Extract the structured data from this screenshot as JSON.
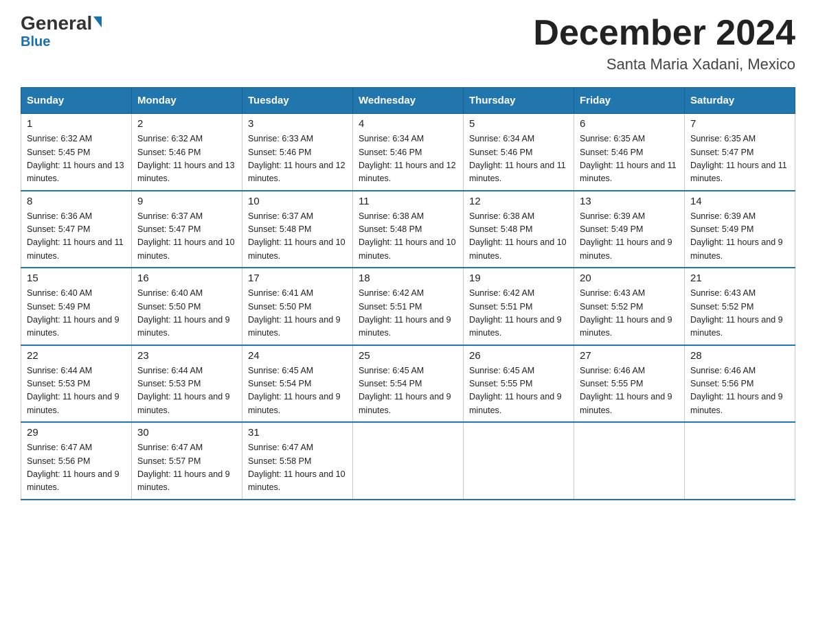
{
  "logo": {
    "general": "General",
    "blue": "Blue"
  },
  "title": "December 2024",
  "subtitle": "Santa Maria Xadani, Mexico",
  "days_of_week": [
    "Sunday",
    "Monday",
    "Tuesday",
    "Wednesday",
    "Thursday",
    "Friday",
    "Saturday"
  ],
  "weeks": [
    [
      {
        "day": "1",
        "sunrise": "6:32 AM",
        "sunset": "5:45 PM",
        "daylight": "11 hours and 13 minutes."
      },
      {
        "day": "2",
        "sunrise": "6:32 AM",
        "sunset": "5:46 PM",
        "daylight": "11 hours and 13 minutes."
      },
      {
        "day": "3",
        "sunrise": "6:33 AM",
        "sunset": "5:46 PM",
        "daylight": "11 hours and 12 minutes."
      },
      {
        "day": "4",
        "sunrise": "6:34 AM",
        "sunset": "5:46 PM",
        "daylight": "11 hours and 12 minutes."
      },
      {
        "day": "5",
        "sunrise": "6:34 AM",
        "sunset": "5:46 PM",
        "daylight": "11 hours and 11 minutes."
      },
      {
        "day": "6",
        "sunrise": "6:35 AM",
        "sunset": "5:46 PM",
        "daylight": "11 hours and 11 minutes."
      },
      {
        "day": "7",
        "sunrise": "6:35 AM",
        "sunset": "5:47 PM",
        "daylight": "11 hours and 11 minutes."
      }
    ],
    [
      {
        "day": "8",
        "sunrise": "6:36 AM",
        "sunset": "5:47 PM",
        "daylight": "11 hours and 11 minutes."
      },
      {
        "day": "9",
        "sunrise": "6:37 AM",
        "sunset": "5:47 PM",
        "daylight": "11 hours and 10 minutes."
      },
      {
        "day": "10",
        "sunrise": "6:37 AM",
        "sunset": "5:48 PM",
        "daylight": "11 hours and 10 minutes."
      },
      {
        "day": "11",
        "sunrise": "6:38 AM",
        "sunset": "5:48 PM",
        "daylight": "11 hours and 10 minutes."
      },
      {
        "day": "12",
        "sunrise": "6:38 AM",
        "sunset": "5:48 PM",
        "daylight": "11 hours and 10 minutes."
      },
      {
        "day": "13",
        "sunrise": "6:39 AM",
        "sunset": "5:49 PM",
        "daylight": "11 hours and 9 minutes."
      },
      {
        "day": "14",
        "sunrise": "6:39 AM",
        "sunset": "5:49 PM",
        "daylight": "11 hours and 9 minutes."
      }
    ],
    [
      {
        "day": "15",
        "sunrise": "6:40 AM",
        "sunset": "5:49 PM",
        "daylight": "11 hours and 9 minutes."
      },
      {
        "day": "16",
        "sunrise": "6:40 AM",
        "sunset": "5:50 PM",
        "daylight": "11 hours and 9 minutes."
      },
      {
        "day": "17",
        "sunrise": "6:41 AM",
        "sunset": "5:50 PM",
        "daylight": "11 hours and 9 minutes."
      },
      {
        "day": "18",
        "sunrise": "6:42 AM",
        "sunset": "5:51 PM",
        "daylight": "11 hours and 9 minutes."
      },
      {
        "day": "19",
        "sunrise": "6:42 AM",
        "sunset": "5:51 PM",
        "daylight": "11 hours and 9 minutes."
      },
      {
        "day": "20",
        "sunrise": "6:43 AM",
        "sunset": "5:52 PM",
        "daylight": "11 hours and 9 minutes."
      },
      {
        "day": "21",
        "sunrise": "6:43 AM",
        "sunset": "5:52 PM",
        "daylight": "11 hours and 9 minutes."
      }
    ],
    [
      {
        "day": "22",
        "sunrise": "6:44 AM",
        "sunset": "5:53 PM",
        "daylight": "11 hours and 9 minutes."
      },
      {
        "day": "23",
        "sunrise": "6:44 AM",
        "sunset": "5:53 PM",
        "daylight": "11 hours and 9 minutes."
      },
      {
        "day": "24",
        "sunrise": "6:45 AM",
        "sunset": "5:54 PM",
        "daylight": "11 hours and 9 minutes."
      },
      {
        "day": "25",
        "sunrise": "6:45 AM",
        "sunset": "5:54 PM",
        "daylight": "11 hours and 9 minutes."
      },
      {
        "day": "26",
        "sunrise": "6:45 AM",
        "sunset": "5:55 PM",
        "daylight": "11 hours and 9 minutes."
      },
      {
        "day": "27",
        "sunrise": "6:46 AM",
        "sunset": "5:55 PM",
        "daylight": "11 hours and 9 minutes."
      },
      {
        "day": "28",
        "sunrise": "6:46 AM",
        "sunset": "5:56 PM",
        "daylight": "11 hours and 9 minutes."
      }
    ],
    [
      {
        "day": "29",
        "sunrise": "6:47 AM",
        "sunset": "5:56 PM",
        "daylight": "11 hours and 9 minutes."
      },
      {
        "day": "30",
        "sunrise": "6:47 AM",
        "sunset": "5:57 PM",
        "daylight": "11 hours and 9 minutes."
      },
      {
        "day": "31",
        "sunrise": "6:47 AM",
        "sunset": "5:58 PM",
        "daylight": "11 hours and 10 minutes."
      },
      null,
      null,
      null,
      null
    ]
  ]
}
